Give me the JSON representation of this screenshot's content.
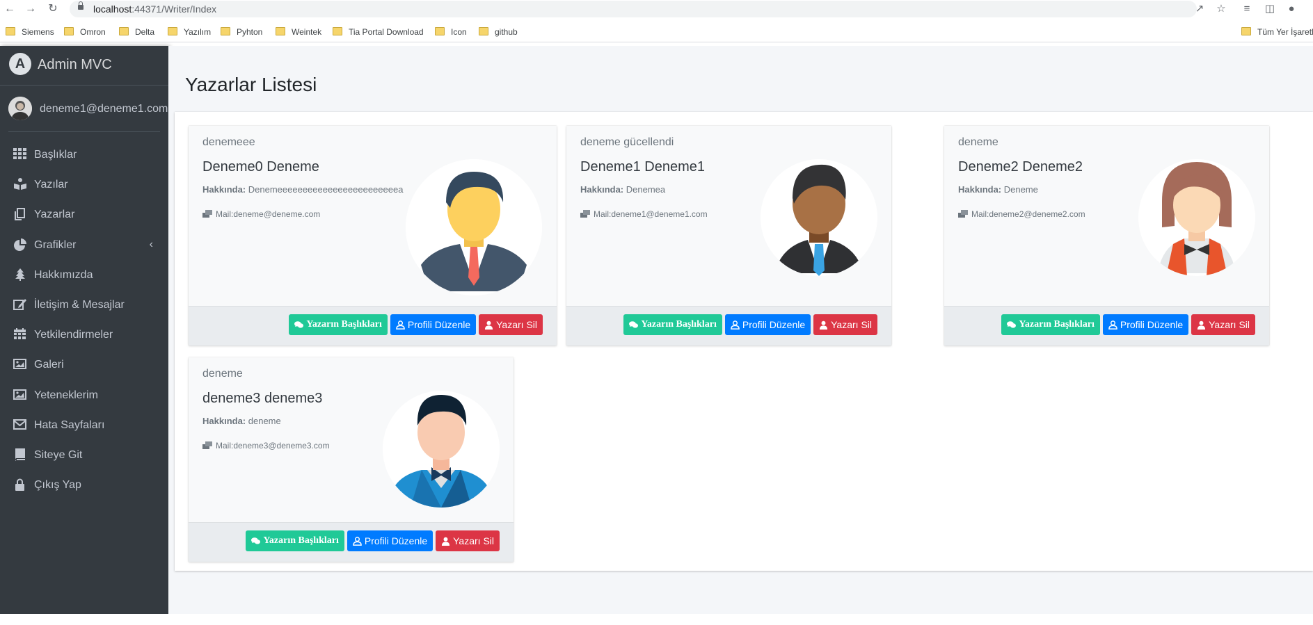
{
  "browser": {
    "url_host": "localhost",
    "url_rest": ":44371/Writer/Index",
    "bookmarks": [
      "Siemens",
      "Omron",
      "Delta",
      "Yazılım",
      "Pyhton",
      "Weintek",
      "Tia Portal Download",
      "Icon",
      "github"
    ],
    "bookmarks_right": "Tüm Yer İşaretle"
  },
  "sidebar": {
    "brand": "Admin MVC",
    "brand_logo": "A",
    "user_email": "deneme1@deneme1.com",
    "items": [
      {
        "label": "Başlıklar",
        "icon": "grid-icon"
      },
      {
        "label": "Yazılar",
        "icon": "book-reader-icon"
      },
      {
        "label": "Yazarlar",
        "icon": "copy-icon"
      },
      {
        "label": "Grafikler",
        "icon": "pie-chart-icon"
      },
      {
        "label": "Hakkımızda",
        "icon": "tree-icon"
      },
      {
        "label": "İletişim & Mesajlar",
        "icon": "edit-icon"
      },
      {
        "label": "Yetkilendirmeler",
        "icon": "calendar-icon"
      },
      {
        "label": "Galeri",
        "icon": "image-icon"
      },
      {
        "label": "Yeteneklerim",
        "icon": "image-icon"
      },
      {
        "label": "Hata Sayfaları",
        "icon": "envelope-icon"
      },
      {
        "label": "Siteye Git",
        "icon": "book-icon"
      },
      {
        "label": "Çıkış Yap",
        "icon": "lock-icon"
      }
    ]
  },
  "main": {
    "title": "Yazarlar Listesi",
    "about_label": "Hakkında:",
    "buttons": {
      "titles": "Yazarın Başlıkları",
      "edit": "Profili Düzenle",
      "delete": "Yazarı Sil"
    },
    "writers": [
      {
        "header": "denemeee",
        "name": "Deneme0 Deneme",
        "about": "Denemeeeeeeeeeeeeeeeeeeeeeeeea",
        "mail": "Mail:deneme@deneme.com",
        "avatar": "man-suit-avatar"
      },
      {
        "header": "deneme gücellendi",
        "name": "Deneme1 Deneme1",
        "about": "Denemea",
        "mail": "Mail:deneme1@deneme1.com",
        "avatar": "man-dark-avatar"
      },
      {
        "header": "deneme",
        "name": "Deneme2 Deneme2",
        "about": "Deneme",
        "mail": "Mail:deneme2@deneme2.com",
        "avatar": "woman-waiter-avatar"
      },
      {
        "header": "deneme",
        "name": "deneme3 deneme3",
        "about": "deneme",
        "mail": "Mail:deneme3@deneme3.com",
        "avatar": "man-bowtie-avatar"
      }
    ]
  },
  "colors": {
    "sidebar_bg": "#343a40",
    "content_bg": "#f4f6f9",
    "btn_green": "#20c997",
    "btn_blue": "#007bff",
    "btn_red": "#dc3545"
  }
}
